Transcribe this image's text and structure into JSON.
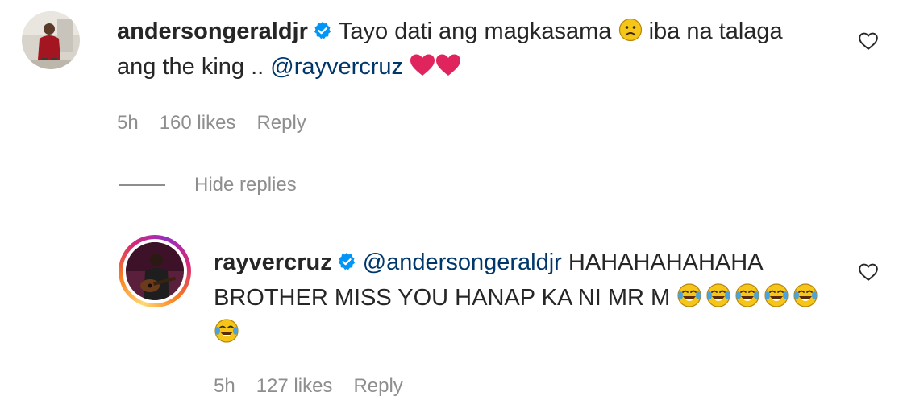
{
  "comments": [
    {
      "username": "andersongeraldjr",
      "verified": true,
      "text_before": "Tayo dati ang magkasama",
      "text_after_emoji": "iba na talaga ang the king ..",
      "mention": "@rayvercruz",
      "emojis": [
        "frowning-face",
        "red-heart",
        "red-heart"
      ],
      "time": "5h",
      "likes": "160 likes",
      "reply_label": "Reply",
      "avatar_icon": "user-avatar-red-shirt"
    }
  ],
  "replies_toggle": {
    "label": "Hide replies"
  },
  "reply": {
    "username": "rayvercruz",
    "verified": true,
    "mention": "@andersongeraldjr",
    "text": "HAHAHAHAHAHA BROTHER MISS YOU HANAP KA NI MR M",
    "emojis": [
      "tears-of-joy",
      "tears-of-joy",
      "tears-of-joy",
      "tears-of-joy",
      "tears-of-joy",
      "tears-of-joy"
    ],
    "time": "5h",
    "likes": "127 likes",
    "reply_label": "Reply",
    "has_story_ring": true,
    "avatar_icon": "user-avatar-guitar"
  },
  "colors": {
    "text": "#262626",
    "secondary": "#8e8e8e",
    "mention": "#00376b",
    "verified": "#0095f6",
    "heart": "#e0245e"
  }
}
